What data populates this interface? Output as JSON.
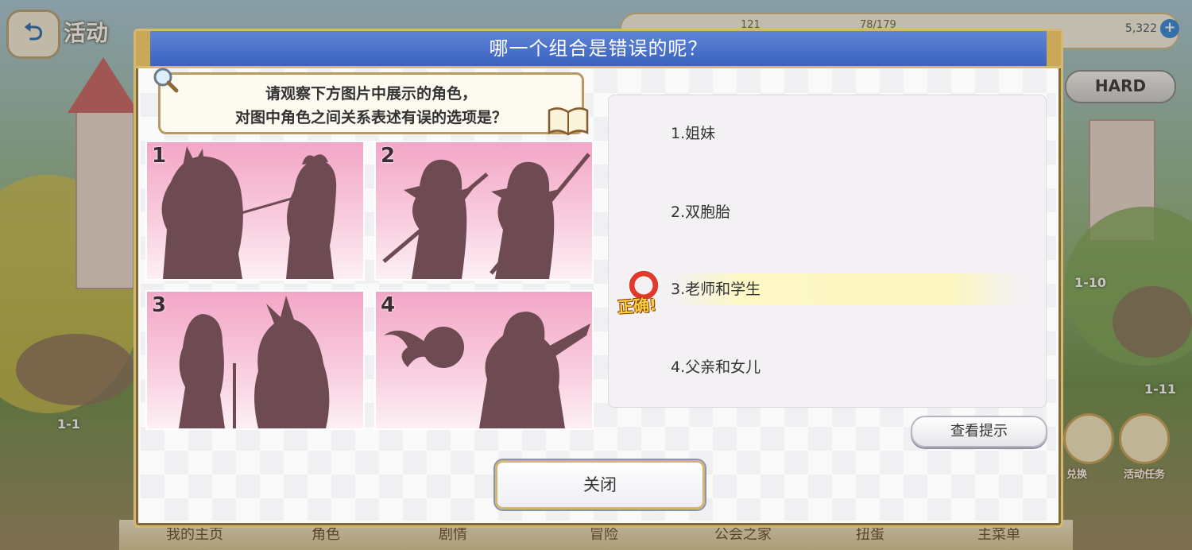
{
  "background": {
    "top_left_title": "活动",
    "back_icon": "return-arrow-icon",
    "status_items": [
      "121",
      "78/179"
    ],
    "gem_count": "5,322",
    "hard_button": "HARD",
    "stage_labels": [
      "1-1",
      "1-10",
      "1-11"
    ],
    "side_buttons": [
      "兑换",
      "活动任务"
    ],
    "bottom_tabs": [
      "我的主页",
      "角色",
      "剧情",
      "冒险",
      "公会之家",
      "扭蛋",
      "主菜单"
    ]
  },
  "dialog": {
    "title": "哪一个组合是错误的呢？",
    "question_line1": "请观察下方图片中展示的角色，",
    "question_line2": "对图中角色之间关系表述有误的选项是？",
    "tiles": [
      "1",
      "2",
      "3",
      "4"
    ],
    "options": [
      "1.姐妹",
      "2.双胞胎",
      "3.老师和学生",
      "4.父亲和女儿"
    ],
    "correct_index": 3,
    "correct_label": "正确!",
    "hint_button": "查看提示",
    "close_button": "关闭"
  },
  "colors": {
    "header_blue": "#4a72cc",
    "frame_gold": "#d6b970",
    "tile_pink": "#f3a6c6",
    "silhouette": "#6e4a52",
    "correct_red": "#e23a2a",
    "highlight_yellow": "#fcf6bf"
  }
}
